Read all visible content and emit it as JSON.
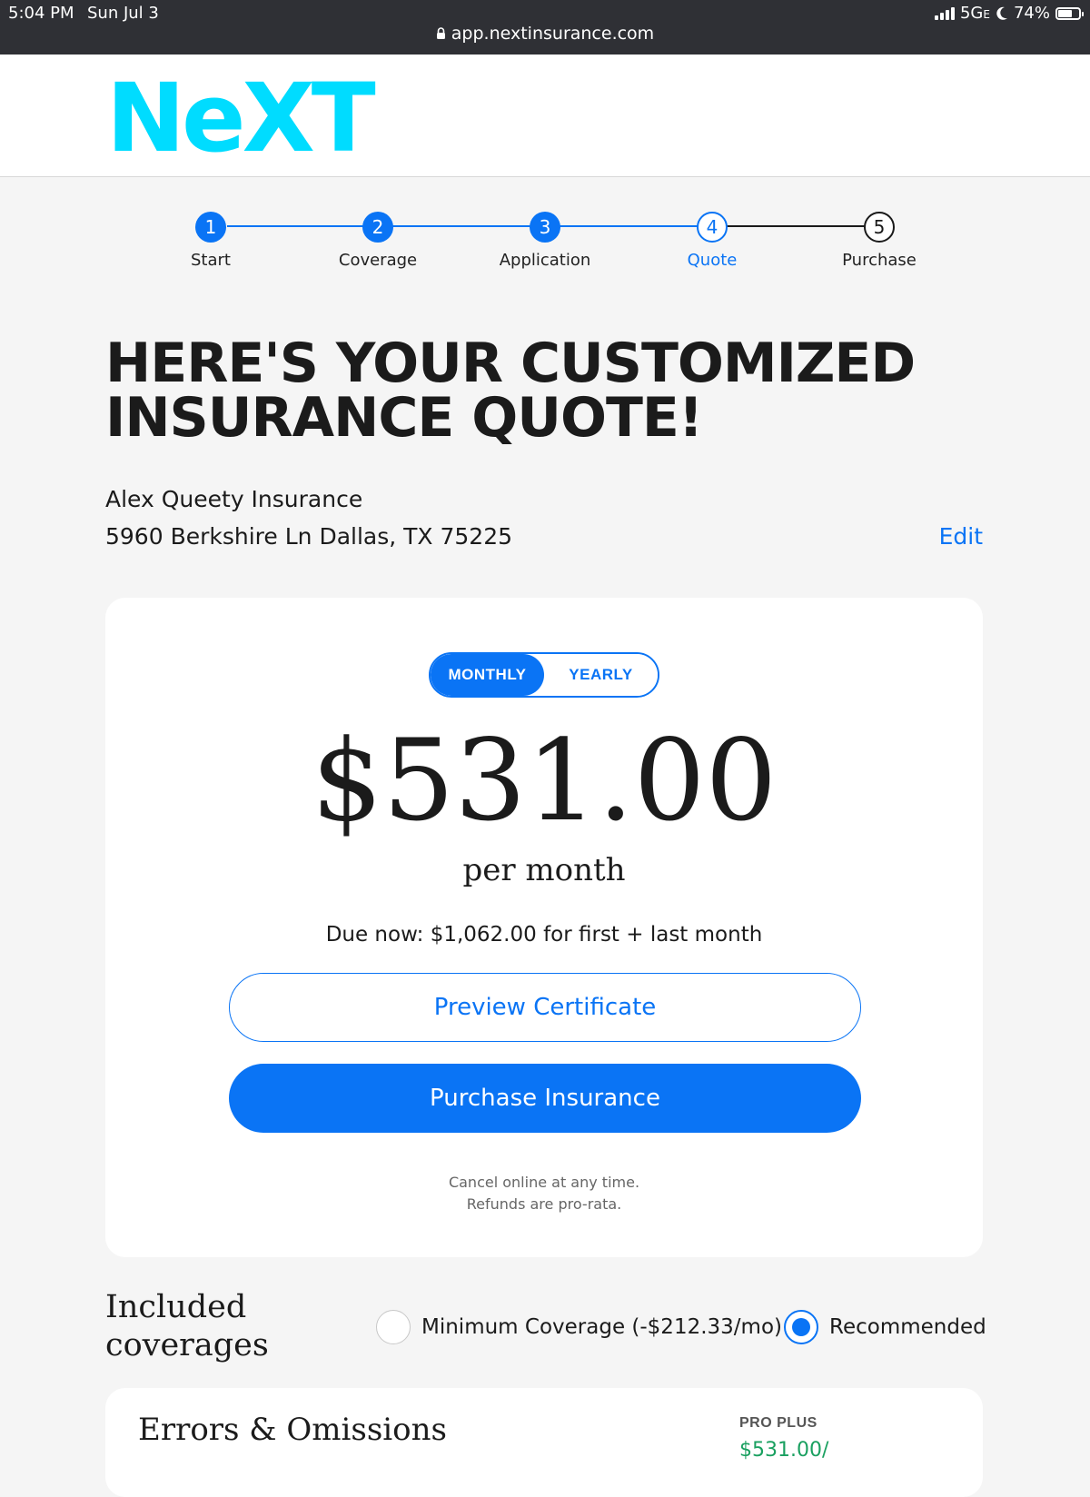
{
  "status_bar": {
    "time": "5:04 PM",
    "date": "Sun Jul 3",
    "network": "5G",
    "network_suffix": "E",
    "battery": "74%",
    "battery_level": 0.74,
    "icons": [
      "signal-icon",
      "moon-icon",
      "battery-icon"
    ]
  },
  "browser": {
    "url": "app.nextinsurance.com",
    "icon": "lock-icon"
  },
  "header": {
    "logo_text": "NeXT",
    "brand_color": "#00dcff"
  },
  "stepper": {
    "accent_color": "#0a74f5",
    "steps": [
      {
        "number": "1",
        "label": "Start",
        "state": "done"
      },
      {
        "number": "2",
        "label": "Coverage",
        "state": "done"
      },
      {
        "number": "3",
        "label": "Application",
        "state": "done"
      },
      {
        "number": "4",
        "label": "Quote",
        "state": "current"
      },
      {
        "number": "5",
        "label": "Purchase",
        "state": "todo"
      }
    ]
  },
  "page_title": "HERE'S YOUR CUSTOMIZED INSURANCE QUOTE!",
  "business": {
    "name": "Alex Queety Insurance",
    "address": "5960 Berkshire Ln Dallas, TX 75225",
    "edit_label": "Edit"
  },
  "quote": {
    "billing_options": [
      "MONTHLY",
      "YEARLY"
    ],
    "selected_billing": "MONTHLY",
    "price": "$531.00",
    "period": "per month",
    "due_now": "Due now: $1,062.00 for first + last month",
    "preview_button": "Preview Certificate",
    "purchase_button": "Purchase Insurance",
    "cancel_note_line1": "Cancel online at any time.",
    "cancel_note_line2": "Refunds are pro-rata."
  },
  "coverages": {
    "title": "Included coverages",
    "options": [
      {
        "label": "Minimum Coverage (-$212.33/mo)",
        "selected": false
      },
      {
        "label": "Recommended",
        "selected": true
      }
    ],
    "first_item": {
      "name": "Errors & Omissions",
      "plan": "PRO PLUS",
      "price": "$531.00/"
    }
  }
}
